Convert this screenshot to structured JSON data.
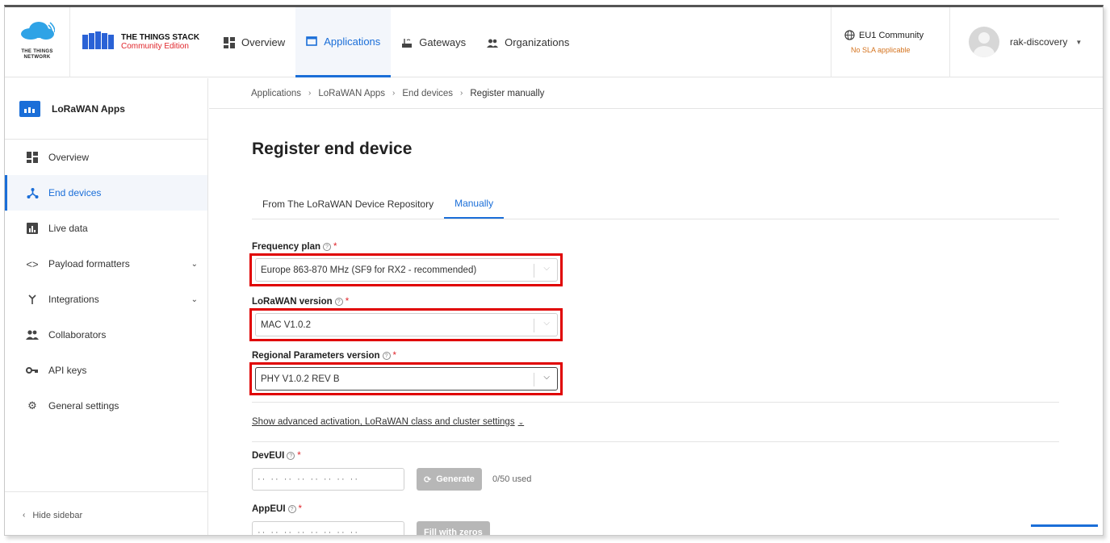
{
  "brand": {
    "ttn_name": "THE THINGS NETWORK",
    "tts_title": "THE THINGS STACK",
    "tts_edition": "Community Edition"
  },
  "nav": {
    "items": [
      {
        "label": "Overview",
        "icon": "grid-icon"
      },
      {
        "label": "Applications",
        "icon": "window-icon",
        "active": true
      },
      {
        "label": "Gateways",
        "icon": "gateway-icon"
      },
      {
        "label": "Organizations",
        "icon": "people-icon"
      }
    ]
  },
  "region": {
    "name": "EU1 Community",
    "sla": "No SLA applicable"
  },
  "user": {
    "name": "rak-discovery"
  },
  "sidebar": {
    "app_name": "LoRaWAN Apps",
    "items": [
      {
        "label": "Overview",
        "icon": "grid-icon"
      },
      {
        "label": "End devices",
        "icon": "devices-icon",
        "active": true
      },
      {
        "label": "Live data",
        "icon": "chart-icon"
      },
      {
        "label": "Payload formatters",
        "icon": "code-icon",
        "expandable": true
      },
      {
        "label": "Integrations",
        "icon": "merge-icon",
        "expandable": true
      },
      {
        "label": "Collaborators",
        "icon": "people-icon"
      },
      {
        "label": "API keys",
        "icon": "key-icon"
      },
      {
        "label": "General settings",
        "icon": "gear-icon"
      }
    ],
    "hide_label": "Hide sidebar"
  },
  "breadcrumb": [
    "Applications",
    "LoRaWAN Apps",
    "End devices",
    "Register manually"
  ],
  "page": {
    "title": "Register end device",
    "tabs": [
      "From The LoRaWAN Device Repository",
      "Manually"
    ],
    "active_tab": "Manually"
  },
  "form": {
    "frequency_plan": {
      "label": "Frequency plan",
      "value": "Europe 863-870 MHz (SF9 for RX2 - recommended)"
    },
    "lorawan_version": {
      "label": "LoRaWAN version",
      "value": "MAC V1.0.2"
    },
    "regional_params": {
      "label": "Regional Parameters version",
      "value": "PHY V1.0.2 REV B"
    },
    "advanced_link": "Show advanced activation, LoRaWAN class and cluster settings",
    "dev_eui": {
      "label": "DevEUI",
      "placeholder": "·· ·· ·· ·· ·· ·· ·· ··",
      "generate": "Generate",
      "used": "0/50 used"
    },
    "app_eui": {
      "label": "AppEUI",
      "placeholder": "·· ·· ·· ·· ·· ·· ·· ··",
      "fill": "Fill with zeros"
    }
  },
  "colors": {
    "accent": "#1a6ed8",
    "highlight": "#e00000",
    "required": "#e0252b",
    "sla": "#d4731e"
  }
}
